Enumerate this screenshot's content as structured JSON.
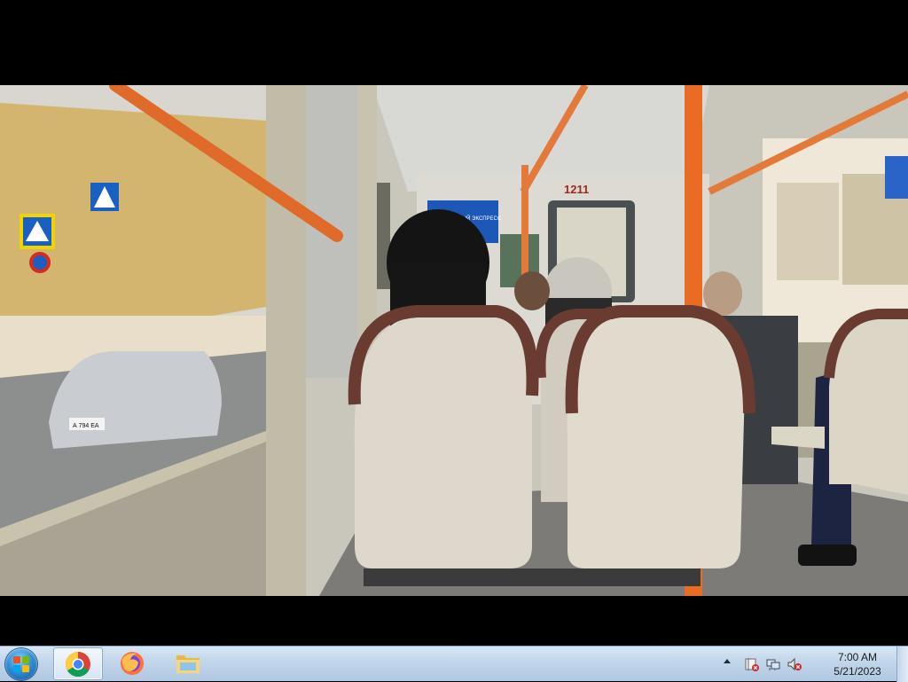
{
  "video": {
    "tram_number": "1211",
    "poster_text": "ВОСТОЧНЫЙ ЭКСПРЕСС",
    "plate_text": "А 794 ЕА"
  },
  "taskbar": {
    "pinned": [
      "chrome-icon",
      "firefox-icon",
      "file-explorer-icon"
    ],
    "tray_icons": [
      "action-center-icon",
      "network-icon",
      "volume-muted-icon"
    ]
  },
  "clock": {
    "time": "7:00 AM",
    "date": "5/21/2023"
  }
}
